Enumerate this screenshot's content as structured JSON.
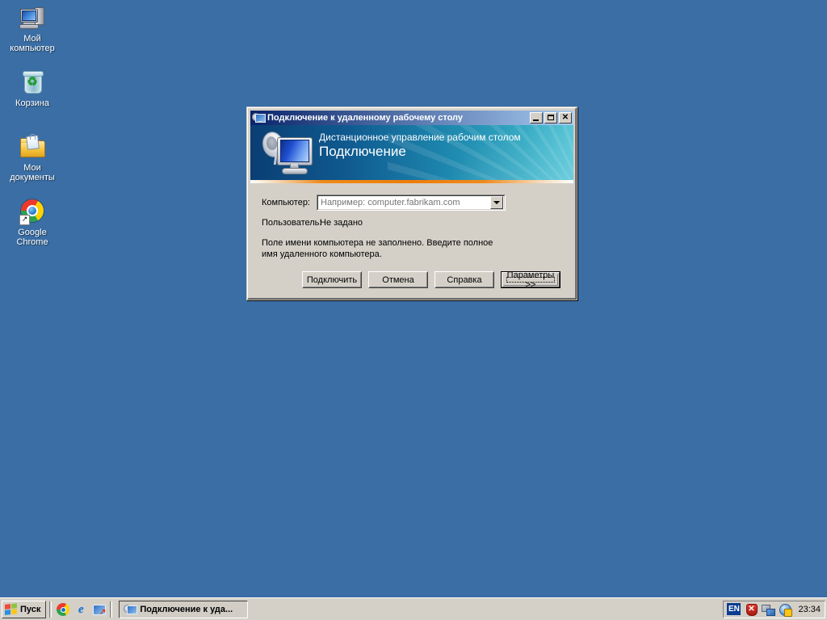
{
  "desktop": {
    "background_color": "#3a6ea5",
    "icons": [
      {
        "name": "my-computer",
        "label": "Мой\nкомпьютер",
        "icon": "my-computer-icon"
      },
      {
        "name": "recycle-bin",
        "label": "Корзина",
        "icon": "recycle-bin-icon"
      },
      {
        "name": "my-documents",
        "label": "Мои\nдокументы",
        "icon": "my-documents-icon"
      },
      {
        "name": "google-chrome",
        "label": "Google Chrome",
        "icon": "chrome-icon"
      }
    ]
  },
  "dialog": {
    "title": "Подключение к удаленному рабочему столу",
    "title_icon": "remote-desktop-icon",
    "window_buttons": {
      "minimize": "minimize-icon",
      "maximize": "maximize-icon",
      "close": "close-icon"
    },
    "banner": {
      "subtitle": "Дистанционное управление рабочим столом",
      "title": "Подключение",
      "icon": "remote-desktop-banner-icon",
      "accent_color": "#ee7d0b",
      "gradient_from": "#0a3e73",
      "gradient_to": "#55c3d4"
    },
    "fields": {
      "computer_label": "Компьютер:",
      "computer_value": "",
      "computer_placeholder": "Например: computer.fabrikam.com",
      "user_label": "Пользователь:",
      "user_value": "Не задано"
    },
    "hint": "Поле имени компьютера не заполнено. Введите полное имя удаленного компьютера.",
    "buttons": [
      {
        "name": "connect-button",
        "label": "Подключить",
        "default": false
      },
      {
        "name": "cancel-button",
        "label": "Отмена",
        "default": false
      },
      {
        "name": "help-button",
        "label": "Справка",
        "default": false
      },
      {
        "name": "options-button",
        "label": "Параметры >>",
        "default": true
      }
    ]
  },
  "taskbar": {
    "start_label": "Пуск",
    "quick_launch": [
      {
        "name": "quicklaunch-chrome",
        "icon": "chrome-icon"
      },
      {
        "name": "quicklaunch-internet-explorer",
        "icon": "internet-explorer-icon",
        "glyph": "e"
      },
      {
        "name": "quicklaunch-remote-desktop",
        "icon": "remote-desktop-icon"
      }
    ],
    "windows": [
      {
        "name": "taskbar-window-rdp",
        "label": "Подключение к уда...",
        "icon": "remote-desktop-icon",
        "active": true
      }
    ],
    "tray": {
      "language": "EN",
      "icons": [
        {
          "name": "security-alert-icon",
          "glyph": "✕"
        },
        {
          "name": "network-connection-icon"
        },
        {
          "name": "windows-update-icon"
        }
      ],
      "clock": "23:34"
    }
  }
}
